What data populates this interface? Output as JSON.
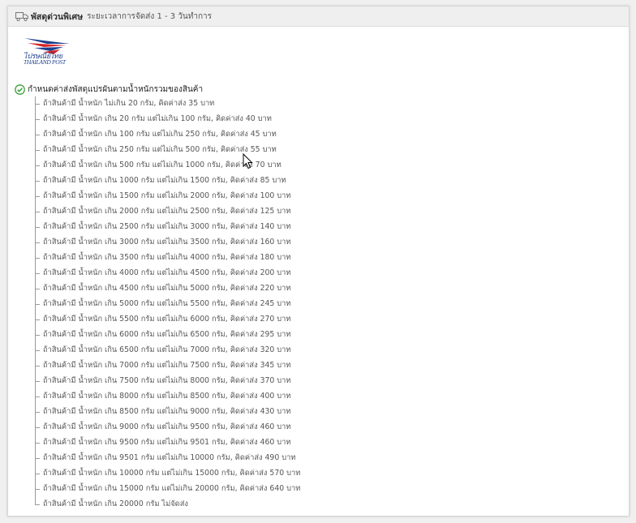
{
  "header": {
    "icon": "truck-icon",
    "title": "พัสดุด่วนพิเศษ",
    "subtitle": "ระยะเวลาการจัดส่ง 1 - 3 วันทำการ"
  },
  "logo": {
    "line1": "ไปรษณีย์ไทย",
    "line2": "THAILAND POST",
    "colors": {
      "blue": "#1d3f8f",
      "red": "#d7272b"
    }
  },
  "rule": {
    "icon": "check-circle-icon",
    "title": "กำหนดค่าส่งพัสดุแปรผันตามน้ำหนักรวมของสินค้า"
  },
  "rates": [
    "ถ้าสินค้ามี น้ำหนัก ไม่เกิน 20 กรัม, คิดค่าส่ง 35 บาท",
    "ถ้าสินค้ามี น้ำหนัก เกิน 20 กรัม แต่ไม่เกิน 100 กรัม, คิดค่าส่ง 40 บาท",
    "ถ้าสินค้ามี น้ำหนัก เกิน 100 กรัม แต่ไม่เกิน 250 กรัม, คิดค่าส่ง 45 บาท",
    "ถ้าสินค้ามี น้ำหนัก เกิน 250 กรัม แต่ไม่เกิน 500 กรัม, คิดค่าส่ง 55 บาท",
    "ถ้าสินค้ามี น้ำหนัก เกิน 500 กรัม แต่ไม่เกิน 1000 กรัม, คิดค่าส่ง 70 บาท",
    "ถ้าสินค้ามี น้ำหนัก เกิน 1000 กรัม แต่ไม่เกิน 1500 กรัม, คิดค่าส่ง 85 บาท",
    "ถ้าสินค้ามี น้ำหนัก เกิน 1500 กรัม แต่ไม่เกิน 2000 กรัม, คิดค่าส่ง 100 บาท",
    "ถ้าสินค้ามี น้ำหนัก เกิน 2000 กรัม แต่ไม่เกิน 2500 กรัม, คิดค่าส่ง 125 บาท",
    "ถ้าสินค้ามี น้ำหนัก เกิน 2500 กรัม แต่ไม่เกิน 3000 กรัม, คิดค่าส่ง 140 บาท",
    "ถ้าสินค้ามี น้ำหนัก เกิน 3000 กรัม แต่ไม่เกิน 3500 กรัม, คิดค่าส่ง 160 บาท",
    "ถ้าสินค้ามี น้ำหนัก เกิน 3500 กรัม แต่ไม่เกิน 4000 กรัม, คิดค่าส่ง 180 บาท",
    "ถ้าสินค้ามี น้ำหนัก เกิน 4000 กรัม แต่ไม่เกิน 4500 กรัม, คิดค่าส่ง 200 บาท",
    "ถ้าสินค้ามี น้ำหนัก เกิน 4500 กรัม แต่ไม่เกิน 5000 กรัม, คิดค่าส่ง 220 บาท",
    "ถ้าสินค้ามี น้ำหนัก เกิน 5000 กรัม แต่ไม่เกิน 5500 กรัม, คิดค่าส่ง 245 บาท",
    "ถ้าสินค้ามี น้ำหนัก เกิน 5500 กรัม แต่ไม่เกิน 6000 กรัม, คิดค่าส่ง 270 บาท",
    "ถ้าสินค้ามี น้ำหนัก เกิน 6000 กรัม แต่ไม่เกิน 6500 กรัม, คิดค่าส่ง 295 บาท",
    "ถ้าสินค้ามี น้ำหนัก เกิน 6500 กรัม แต่ไม่เกิน 7000 กรัม, คิดค่าส่ง 320 บาท",
    "ถ้าสินค้ามี น้ำหนัก เกิน 7000 กรัม แต่ไม่เกิน 7500 กรัม, คิดค่าส่ง 345 บาท",
    "ถ้าสินค้ามี น้ำหนัก เกิน 7500 กรัม แต่ไม่เกิน 8000 กรัม, คิดค่าส่ง 370 บาท",
    "ถ้าสินค้ามี น้ำหนัก เกิน 8000 กรัม แต่ไม่เกิน 8500 กรัม, คิดค่าส่ง 400 บาท",
    "ถ้าสินค้ามี น้ำหนัก เกิน 8500 กรัม แต่ไม่เกิน 9000 กรัม, คิดค่าส่ง 430 บาท",
    "ถ้าสินค้ามี น้ำหนัก เกิน 9000 กรัม แต่ไม่เกิน 9500 กรัม, คิดค่าส่ง 460 บาท",
    "ถ้าสินค้ามี น้ำหนัก เกิน 9500 กรัม แต่ไม่เกิน 9501 กรัม, คิดค่าส่ง 460 บาท",
    "ถ้าสินค้ามี น้ำหนัก เกิน 9501 กรัม แต่ไม่เกิน 10000 กรัม, คิดค่าส่ง 490 บาท",
    "ถ้าสินค้ามี น้ำหนัก เกิน 10000 กรัม แต่ไม่เกิน 15000 กรัม, คิดค่าส่ง 570 บาท",
    "ถ้าสินค้ามี น้ำหนัก เกิน 15000 กรัม แต่ไม่เกิน 20000 กรัม, คิดค่าส่ง 640 บาท",
    "ถ้าสินค้ามี น้ำหนัก เกิน 20000 กรัม ไม่จัดส่ง"
  ]
}
